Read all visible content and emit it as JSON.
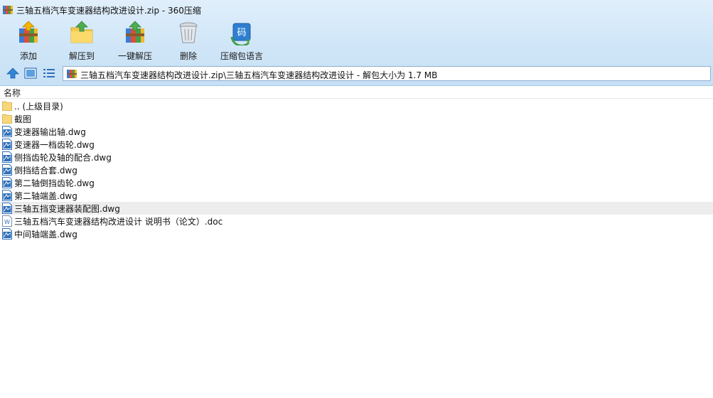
{
  "window": {
    "title": "三轴五档汽车变速器结构改进设计.zip - 360压缩"
  },
  "toolbar": {
    "add_label": "添加",
    "extract_label": "解压到",
    "one_click_label": "一键解压",
    "delete_label": "删除",
    "language_label": "压缩包语言",
    "language_icon_text": "码"
  },
  "address": {
    "path": "三轴五档汽车变速器结构改进设计.zip\\三轴五档汽车变速器结构改进设计 - 解包大小为 1.7 MB"
  },
  "columns": {
    "name": "名称"
  },
  "files": [
    {
      "name": ".. (上级目录)",
      "icon": "folder-icon"
    },
    {
      "name": "截图",
      "icon": "folder-icon"
    },
    {
      "name": "变速器输出轴.dwg",
      "icon": "dwg-file-icon"
    },
    {
      "name": "变速器一档齿轮.dwg",
      "icon": "dwg-file-icon"
    },
    {
      "name": "侧挡齿轮及轴的配合.dwg",
      "icon": "dwg-file-icon"
    },
    {
      "name": "倒挡结合套.dwg",
      "icon": "dwg-file-icon"
    },
    {
      "name": "第二轴倒挡齿轮.dwg",
      "icon": "dwg-file-icon"
    },
    {
      "name": "第二轴端盖.dwg",
      "icon": "dwg-file-icon"
    },
    {
      "name": "三轴五挡变速器装配图.dwg",
      "icon": "dwg-file-icon"
    },
    {
      "name": "三轴五档汽车变速器结构改进设计 说明书（论文）.doc",
      "icon": "doc-file-icon"
    },
    {
      "name": "中间轴端盖.dwg",
      "icon": "dwg-file-icon"
    }
  ],
  "colors": {
    "toolbar_gradient_top": "#e0effb",
    "toolbar_gradient_bottom": "#c6e0f5",
    "hover_row": "#ededed",
    "folder": "#f6d77a",
    "dwg_blue": "#2f6fb8"
  }
}
